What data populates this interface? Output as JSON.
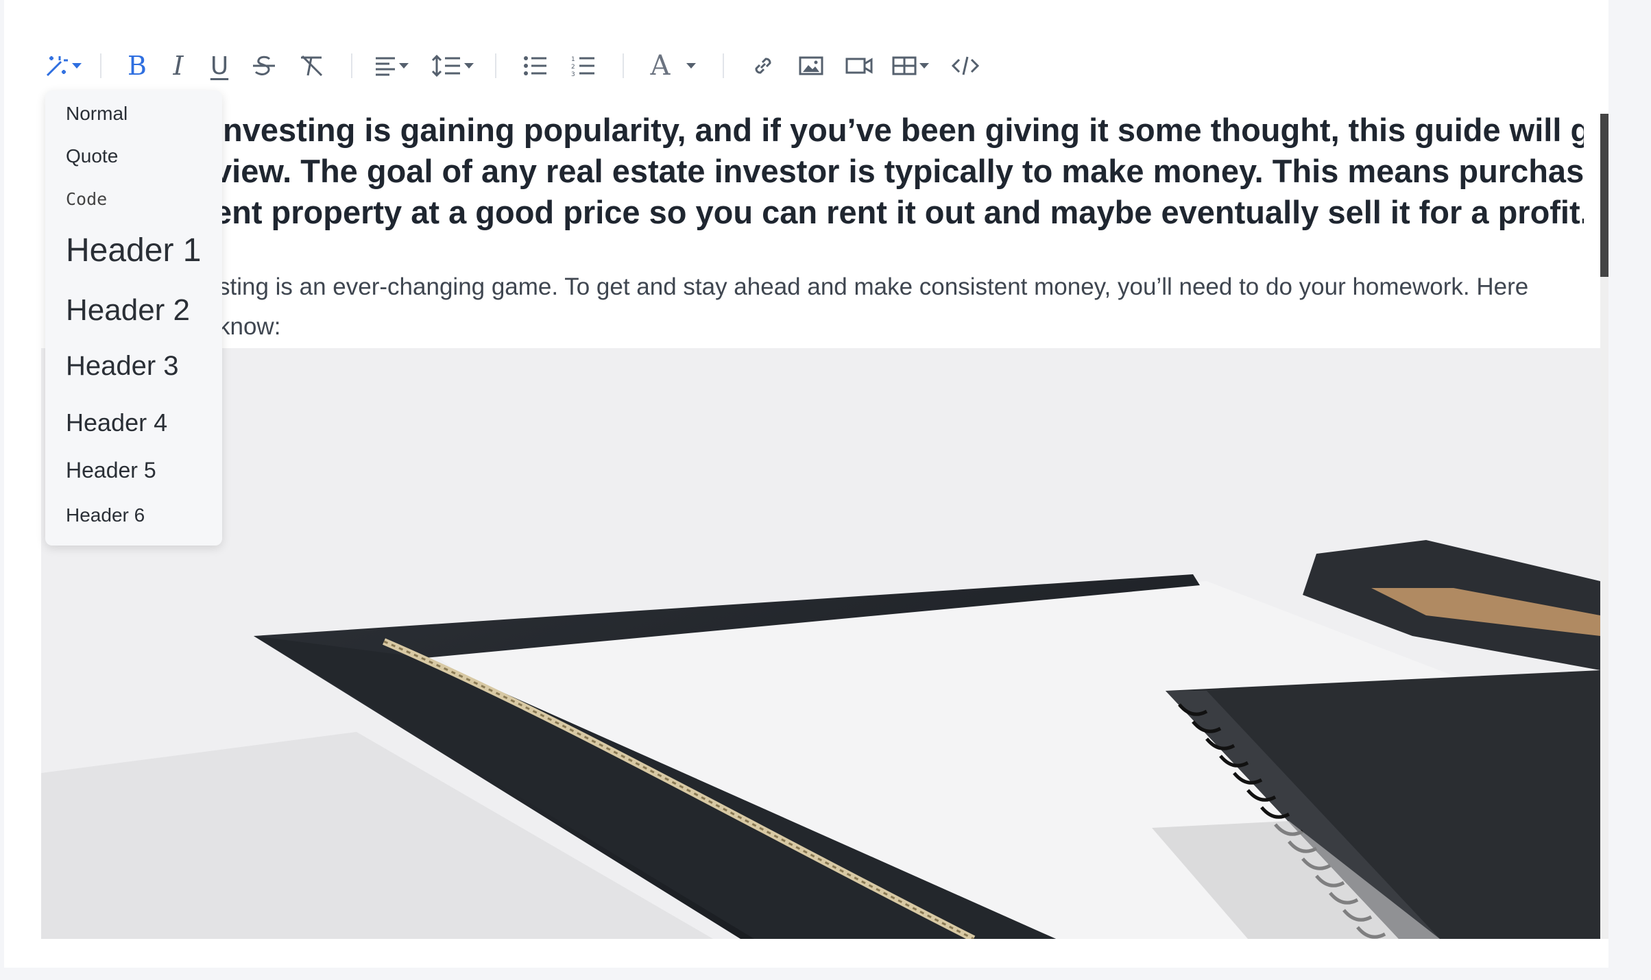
{
  "toolbar": {
    "buttons": [
      {
        "name": "format-magic-button",
        "icon": "magic-wand-icon"
      },
      {
        "name": "bold-button",
        "icon": "bold-icon",
        "glyph": "B"
      },
      {
        "name": "italic-button",
        "icon": "italic-icon",
        "glyph": "I"
      },
      {
        "name": "underline-button",
        "icon": "underline-icon",
        "glyph": "U"
      },
      {
        "name": "strikethrough-button",
        "icon": "strikethrough-icon"
      },
      {
        "name": "clear-format-button",
        "icon": "clear-format-icon"
      },
      {
        "name": "align-button",
        "icon": "align-left-icon"
      },
      {
        "name": "line-height-button",
        "icon": "line-height-icon"
      },
      {
        "name": "bullet-list-button",
        "icon": "bullet-list-icon"
      },
      {
        "name": "numbered-list-button",
        "icon": "numbered-list-icon"
      },
      {
        "name": "text-color-button",
        "icon": "font-color-icon",
        "glyph": "A"
      },
      {
        "name": "link-button",
        "icon": "link-icon"
      },
      {
        "name": "image-button",
        "icon": "image-icon"
      },
      {
        "name": "video-button",
        "icon": "video-icon"
      },
      {
        "name": "table-button",
        "icon": "table-icon"
      },
      {
        "name": "code-view-button",
        "icon": "code-icon"
      }
    ],
    "active_color": "#2f6fe0",
    "icon_color": "#55606e"
  },
  "style_dropdown": {
    "items": [
      {
        "label": "Normal"
      },
      {
        "label": "Quote"
      },
      {
        "label": "Code"
      },
      {
        "label": "Header 1"
      },
      {
        "label": "Header 2"
      },
      {
        "label": "Header 3"
      },
      {
        "label": "Header 4"
      },
      {
        "label": "Header 5"
      },
      {
        "label": "Header 6"
      }
    ]
  },
  "content": {
    "lead_lines": [
      "investing is gaining popularity, and if you’ve been giving it some thought, this guide will give",
      "view. The goal of any real estate investor is typically to make money. This means purchasing",
      "ent property at a good price so you can rent it out and maybe eventually sell it for a profit."
    ],
    "body_lines": [
      "sting is an ever-changing game. To get and stay ahead and make consistent money, you’ll need to do your homework. Here",
      "know:"
    ]
  }
}
